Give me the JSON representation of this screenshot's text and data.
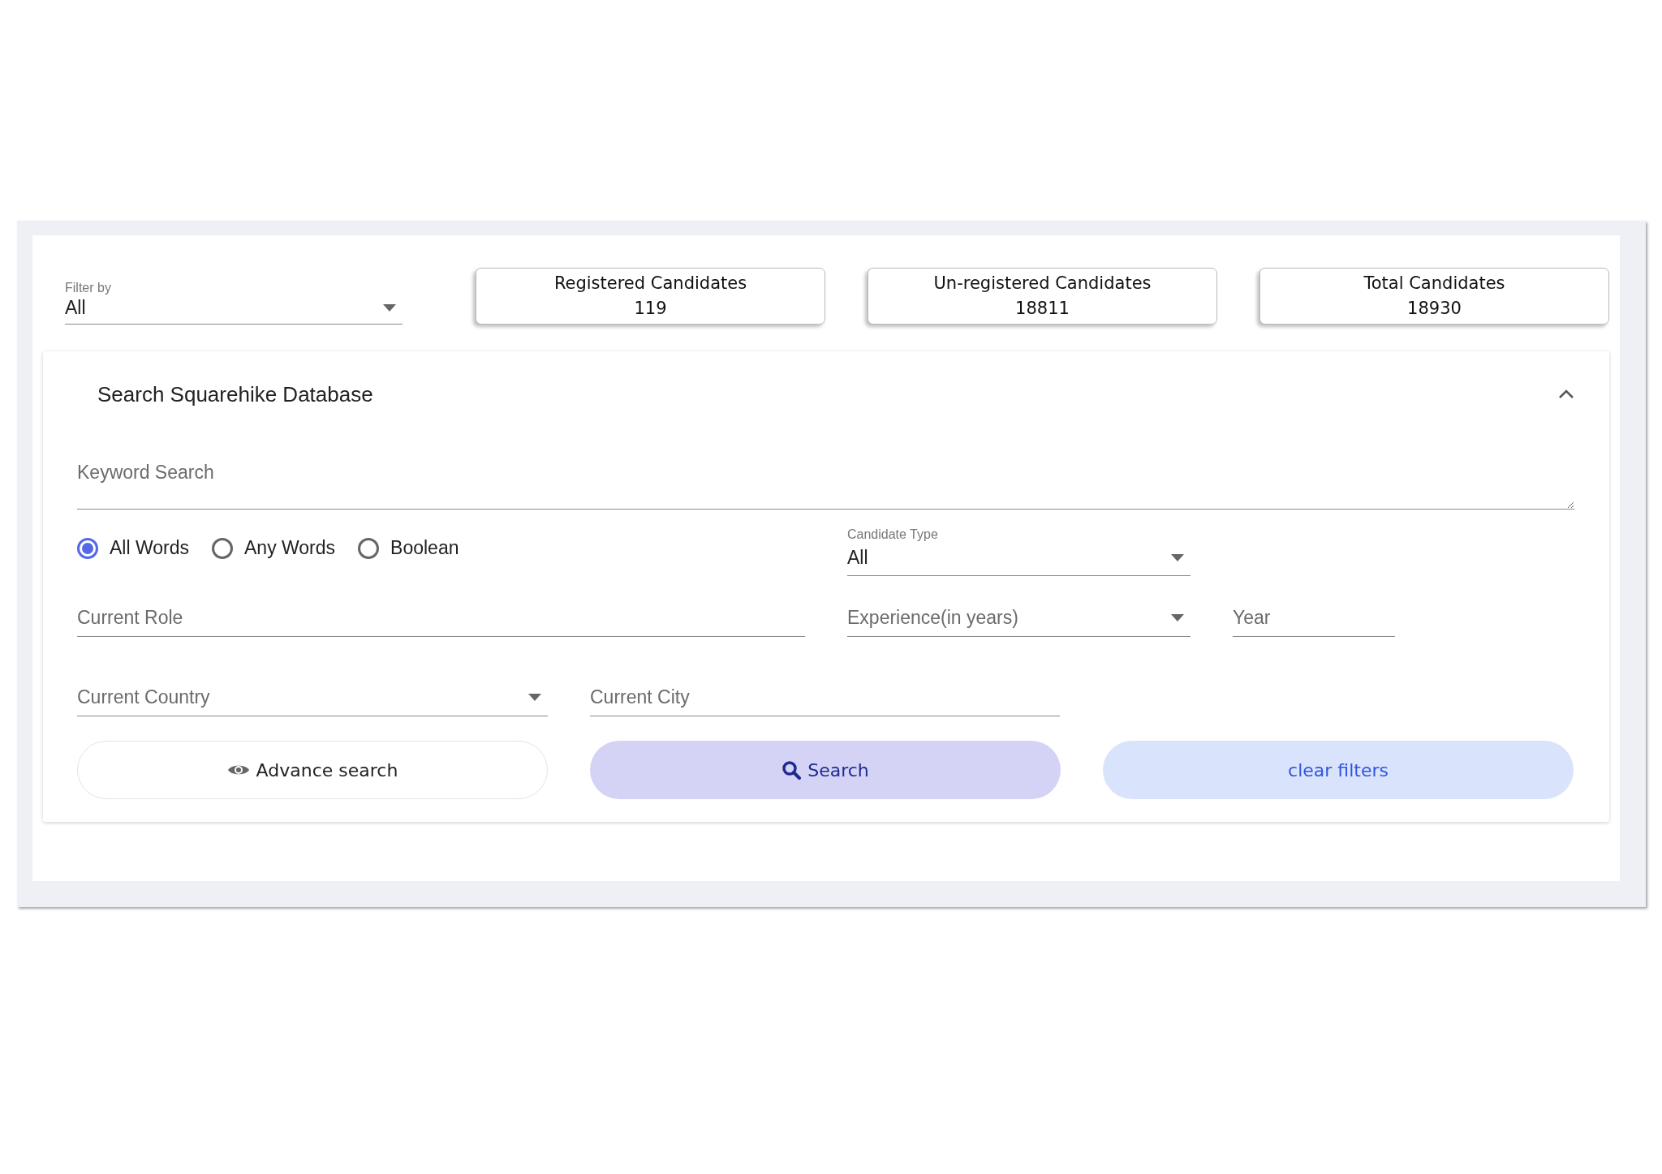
{
  "filter": {
    "label": "Filter by",
    "value": "All"
  },
  "stats": [
    {
      "label": "Registered Candidates",
      "value": "119"
    },
    {
      "label": "Un-registered Candidates",
      "value": "18811"
    },
    {
      "label": "Total Candidates",
      "value": "18930"
    }
  ],
  "panel": {
    "title": "Search Squarehike Database",
    "expanded": true,
    "keyword": {
      "placeholder": "Keyword Search"
    },
    "match_modes": [
      {
        "label": "All Words",
        "selected": true
      },
      {
        "label": "Any Words",
        "selected": false
      },
      {
        "label": "Boolean",
        "selected": false
      }
    ],
    "candidate_type": {
      "label": "Candidate Type",
      "value": "All"
    },
    "field_rows": [
      [
        {
          "kind": "text",
          "placeholder": "Current Role"
        },
        {
          "kind": "select",
          "placeholder": "Experience(in years)"
        },
        {
          "kind": "text",
          "placeholder": "Year"
        }
      ],
      [
        {
          "kind": "select",
          "placeholder": "Current Country"
        },
        {
          "kind": "text",
          "placeholder": "Current City"
        }
      ]
    ],
    "buttons": [
      {
        "kind": "outline",
        "label": "Advance search"
      },
      {
        "kind": "primary",
        "label": "Search"
      },
      {
        "kind": "secondary",
        "label": "clear filters"
      }
    ]
  }
}
